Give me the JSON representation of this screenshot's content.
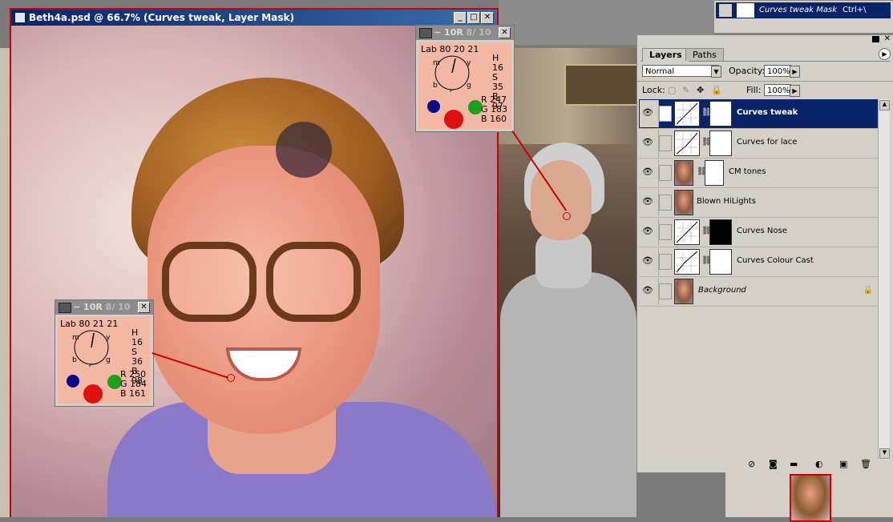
{
  "document": {
    "title": "Beth4a.psd @ 66.7% (Curves tweak, Layer Mask)",
    "buttons": [
      "_",
      "□",
      "✕"
    ]
  },
  "samplers": [
    {
      "title": "~ 10R",
      "dim": "8/ 10",
      "lab": "Lab 80 20 21",
      "H": "H 16",
      "S": "S 35",
      "B": "B 97",
      "R": "R  247",
      "G": "G  183",
      "Bv": "B  160",
      "dial_labels": [
        "m",
        "y",
        "b",
        "c",
        "g"
      ]
    },
    {
      "title": "~ 10R",
      "dim": "8/ 10",
      "lab": "Lab 80 21 21",
      "H": "H 16",
      "S": "S 36",
      "B": "B 98",
      "R": "R  250",
      "G": "G  184",
      "Bv": "B  161",
      "dial_labels": [
        "m",
        "y",
        "b",
        "c",
        "g"
      ]
    }
  ],
  "mask_panel": {
    "label": "Curves tweak Mask",
    "shortcut": "Ctrl+\\"
  },
  "layers_panel": {
    "tabs": [
      "Layers",
      "Paths"
    ],
    "blend_mode": "Normal",
    "opacity_label": "Opacity:",
    "opacity_value": "100%",
    "lock_label": "Lock:",
    "fill_label": "Fill:",
    "fill_value": "100%",
    "layers": [
      {
        "name": "Curves tweak",
        "thumb": "curve",
        "mask": "white",
        "selected": true
      },
      {
        "name": "Curves  for lace",
        "thumb": "curve",
        "mask": "white",
        "selected": false
      },
      {
        "name": "CM tones",
        "thumb": "photo",
        "mask": "white",
        "selected": false
      },
      {
        "name": "Blown HiLights",
        "thumb": "photo",
        "mask": "none",
        "selected": false
      },
      {
        "name": "Curves Nose",
        "thumb": "curve",
        "mask": "black",
        "selected": false
      },
      {
        "name": "Curves Colour Cast",
        "thumb": "curve",
        "mask": "white",
        "selected": false
      },
      {
        "name": "Background",
        "thumb": "photo",
        "mask": "none",
        "selected": false,
        "locked": true
      }
    ],
    "footer_icons": [
      "layer-style-icon",
      "add-mask-icon",
      "new-set-icon",
      "adjustment-layer-icon",
      "new-layer-icon",
      "trash-icon"
    ]
  },
  "colors": {
    "sampler_bg": "#f2b8a3",
    "title_blue": "#0a246a",
    "red": "#cc0000"
  }
}
